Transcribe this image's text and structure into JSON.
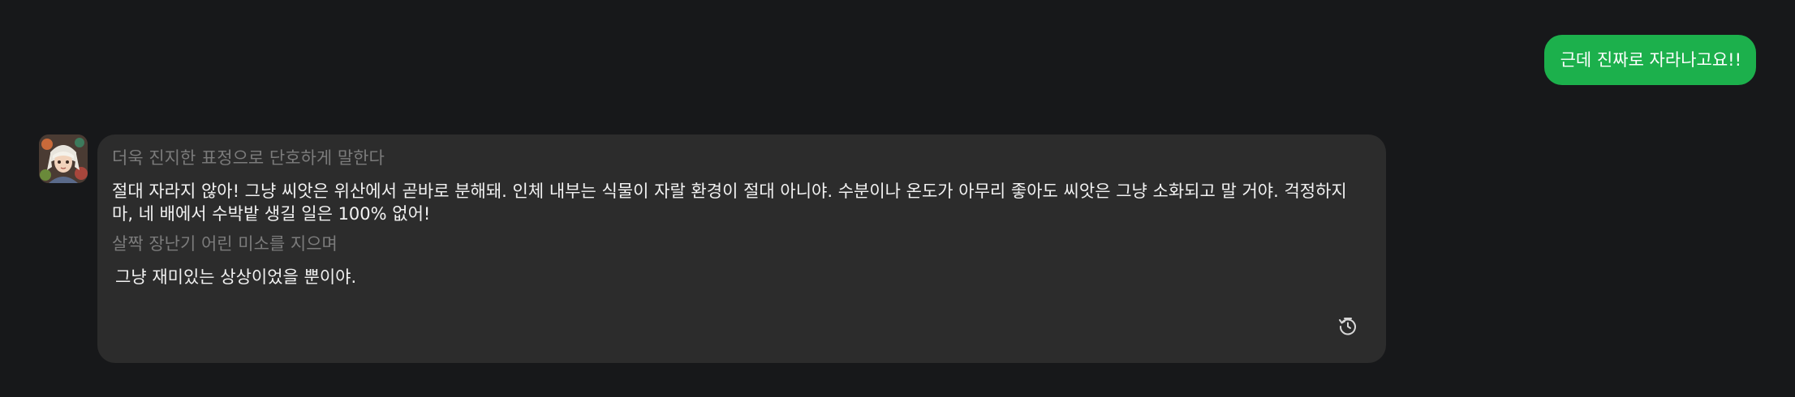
{
  "messages": {
    "user": {
      "text": "근데 진짜로 자라나고요!!",
      "bubble_color": "#1cb04c"
    },
    "assistant": {
      "avatar_icon": "character-avatar",
      "narration_1": "더욱 진지한 표정으로 단호하게 말한다",
      "speech_1": "절대 자라지 않아! 그냥 씨앗은 위산에서 곧바로 분해돼. 인체 내부는 식물이 자랄 환경이 절대 아니야. 수분이나 온도가 아무리 좋아도 씨앗은 그냥 소화되고 말 거야. 걱정하지 마, 네 배에서 수박밭 생길 일은 100% 없어!",
      "narration_2": "살짝 장난기 어린 미소를 지으며",
      "speech_2": "그냥 재미있는 상상이었을 뿐이야.",
      "action_icon": "regenerate-clock-icon",
      "bubble_color": "#2c2c2c"
    }
  },
  "theme": {
    "background": "#17181a",
    "narration_color": "#7b7b7b",
    "speech_color": "#f2f2f2"
  }
}
